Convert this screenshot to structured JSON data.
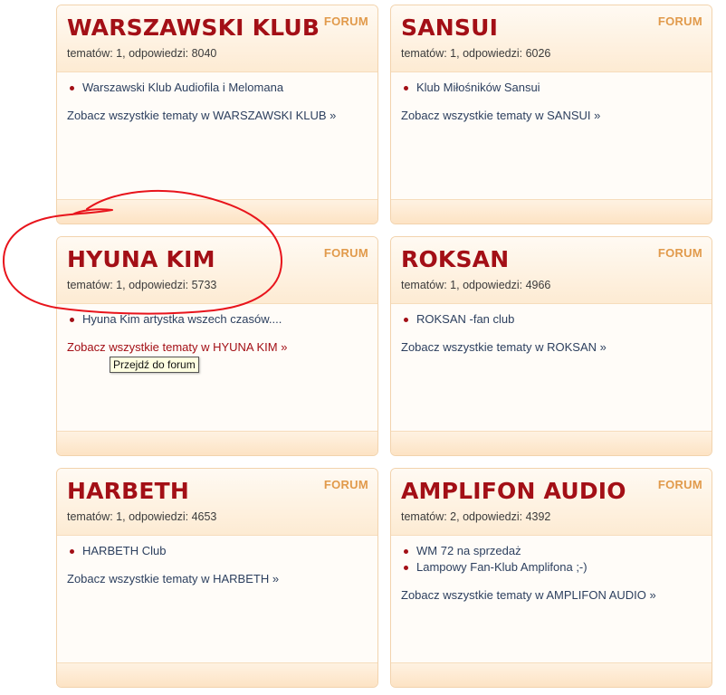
{
  "forum_tag": "FORUM",
  "cards": [
    {
      "title": "WARSZAWSKI KLUB",
      "stats": "tematów: 1, odpowiedzi: 8040",
      "topics": [
        "Warszawski Klub Audiofila i Melomana"
      ],
      "see_all": "Zobacz wszystkie tematy w WARSZAWSKI KLUB »"
    },
    {
      "title": "SANSUI",
      "stats": "tematów: 1, odpowiedzi: 6026",
      "topics": [
        "Klub Miłośników Sansui"
      ],
      "see_all": "Zobacz wszystkie tematy w SANSUI »"
    },
    {
      "title": "HYUNA KIM",
      "stats": "tematów: 1, odpowiedzi: 5733",
      "topics": [
        "Hyuna Kim artystka wszech czasów...."
      ],
      "see_all": "Zobacz wszystkie tematy w HYUNA KIM »"
    },
    {
      "title": "ROKSAN",
      "stats": "tematów: 1, odpowiedzi: 4966",
      "topics": [
        "ROKSAN -fan club"
      ],
      "see_all": "Zobacz wszystkie tematy w ROKSAN »"
    },
    {
      "title": "HARBETH",
      "stats": "tematów: 1, odpowiedzi: 4653",
      "topics": [
        "HARBETH Club"
      ],
      "see_all": "Zobacz wszystkie tematy w HARBETH »"
    },
    {
      "title": "AMPLIFON AUDIO",
      "stats": "tematów: 2, odpowiedzi: 4392",
      "topics": [
        "WM 72 na sprzedaż",
        "Lampowy Fan-Klub Amplifona ;-)"
      ],
      "see_all": "Zobacz wszystkie tematy w AMPLIFON AUDIO »"
    }
  ],
  "tooltip": "Przejdź do forum",
  "colors": {
    "title": "#a30f16",
    "forum_tag": "#e19a4b",
    "link": "#2c3f5e",
    "link_hover": "#a30f16",
    "annotation": "#e8141c"
  },
  "hovered_card": 2
}
